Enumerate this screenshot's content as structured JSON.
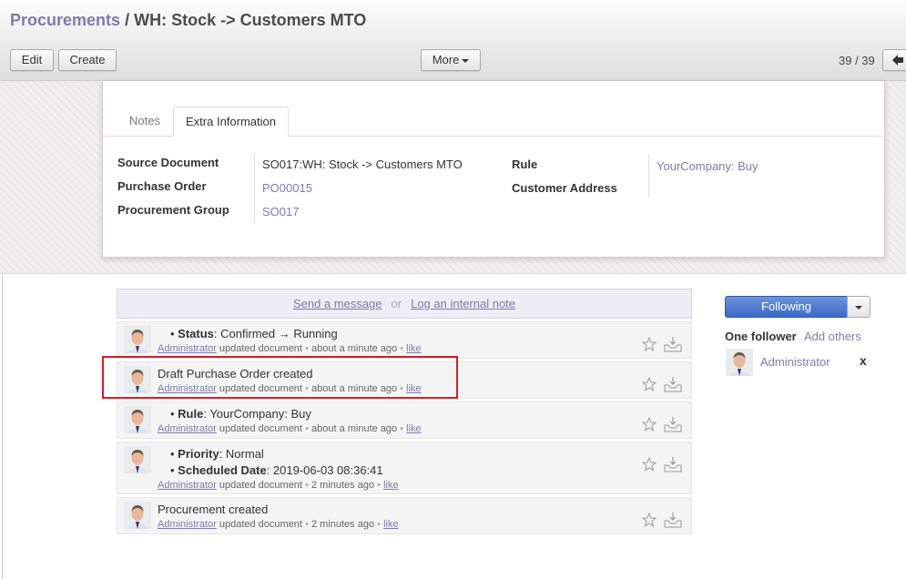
{
  "breadcrumb": {
    "parent": "Procurements",
    "separator": "/",
    "current": "WH: Stock -> Customers MTO"
  },
  "toolbar": {
    "edit_label": "Edit",
    "create_label": "Create",
    "more_label": "More"
  },
  "pager": {
    "value": "39 / 39"
  },
  "tabs": [
    {
      "label": "Notes"
    },
    {
      "label": "Extra Information"
    }
  ],
  "fields": {
    "source_document": {
      "label": "Source Document",
      "value": "SO017:WH: Stock -> Customers MTO"
    },
    "purchase_order": {
      "label": "Purchase Order",
      "value": "PO00015"
    },
    "procurement_group": {
      "label": "Procurement Group",
      "value": "SO017"
    },
    "rule": {
      "label": "Rule",
      "value": "YourCompany: Buy"
    },
    "customer_address": {
      "label": "Customer Address",
      "value": ""
    }
  },
  "composer": {
    "send_message": "Send a message",
    "or": "or",
    "log_note": "Log an internal note"
  },
  "messages": [
    {
      "lines": [
        {
          "key": "Status",
          "value": ": Confirmed → Running"
        }
      ],
      "author": "Administrator",
      "action": "updated document",
      "time": "about a minute ago",
      "like": "like"
    },
    {
      "text": "Draft Purchase Order created",
      "author": "Administrator",
      "action": "updated document",
      "time": "about a minute ago",
      "like": "like"
    },
    {
      "lines": [
        {
          "key": "Rule",
          "value": ": YourCompany: Buy"
        }
      ],
      "author": "Administrator",
      "action": "updated document",
      "time": "about a minute ago",
      "like": "like"
    },
    {
      "lines": [
        {
          "key": "Priority",
          "value": ": Normal"
        },
        {
          "key": "Scheduled Date",
          "value": ": 2019-06-03 08:36:41"
        }
      ],
      "author": "Administrator",
      "action": "updated document",
      "time": "2 minutes ago",
      "like": "like"
    },
    {
      "text": "Procurement created",
      "author": "Administrator",
      "action": "updated document",
      "time": "2 minutes ago",
      "like": "like"
    }
  ],
  "followers": {
    "button_label": "Following",
    "title": "One follower",
    "add_label": "Add others",
    "items": [
      {
        "name": "Administrator",
        "remove": "x"
      }
    ]
  },
  "colors": {
    "link": "#7c7bad",
    "highlight": "#d21f26",
    "following": "#3b6ac6"
  }
}
